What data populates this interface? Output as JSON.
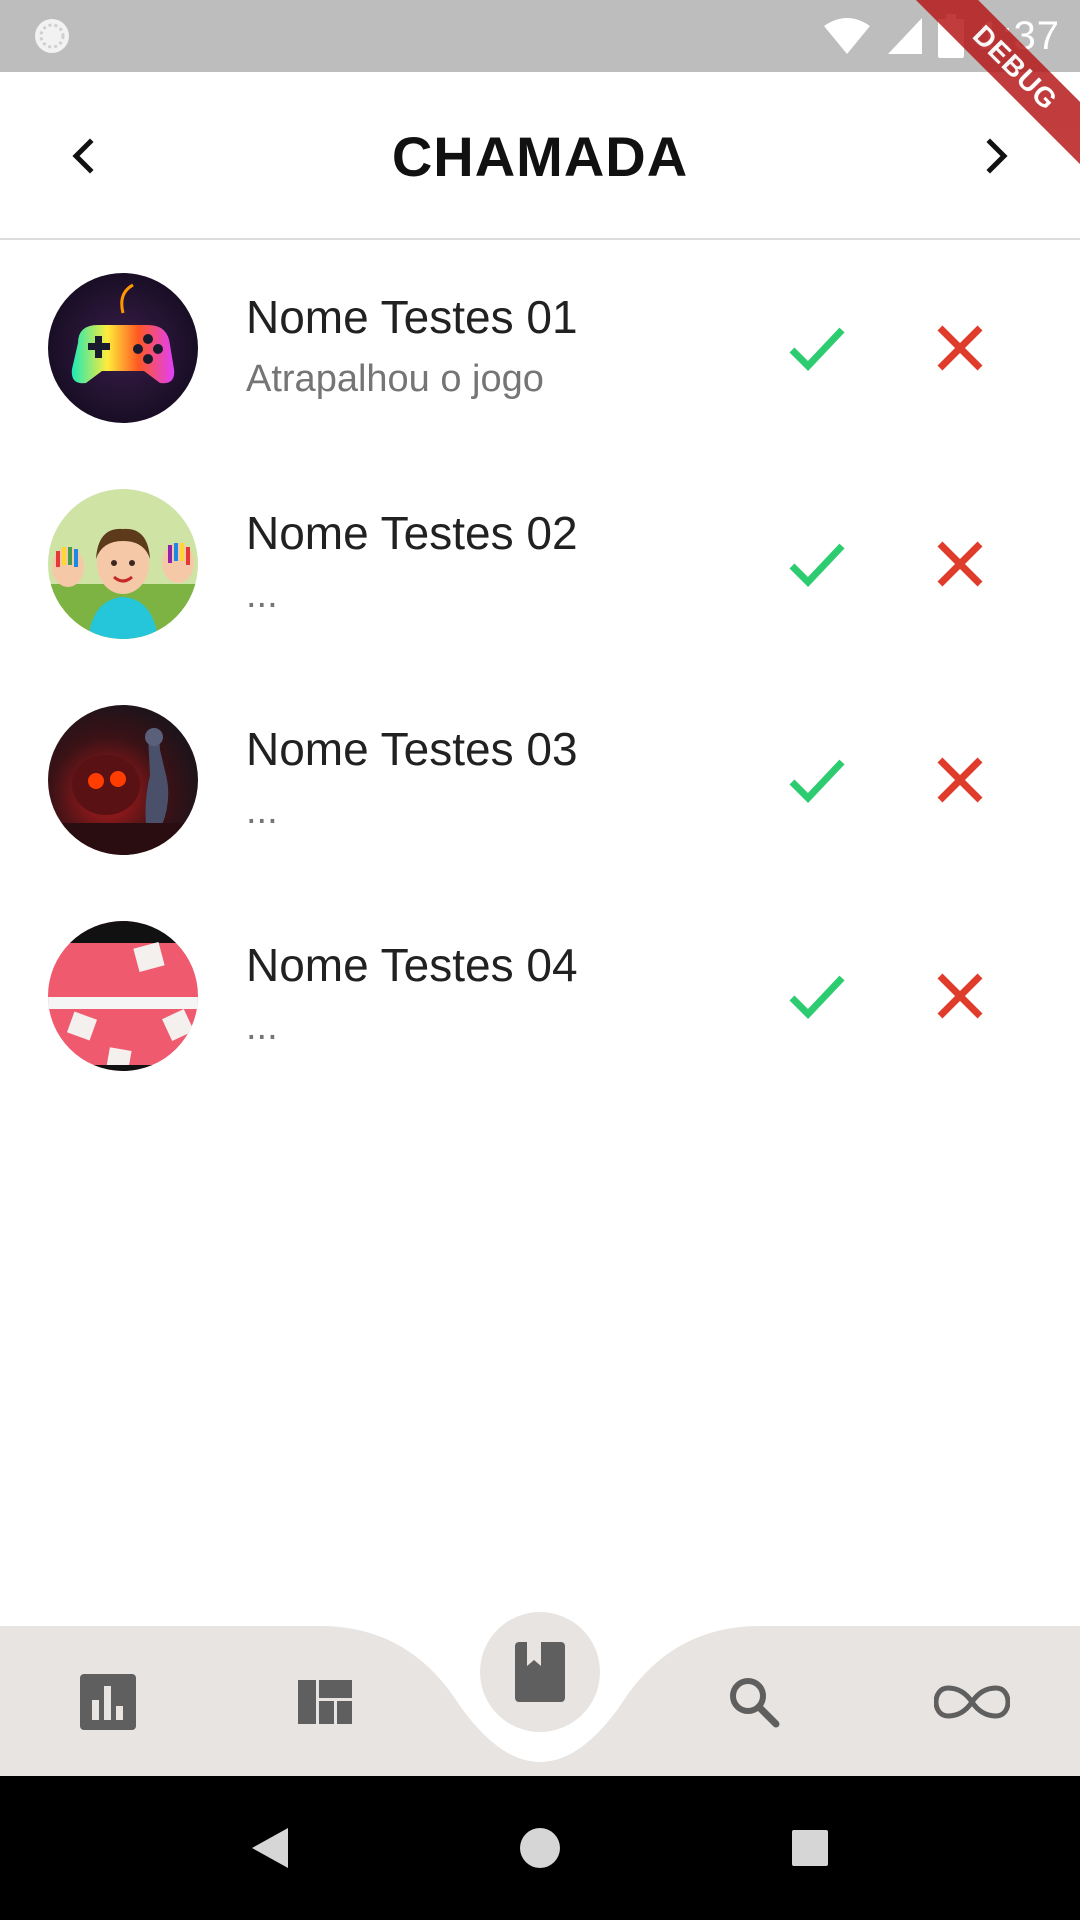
{
  "status_bar": {
    "time": "1:37",
    "icons": [
      "loading-circle-icon",
      "wifi-icon",
      "signal-icon",
      "battery-icon"
    ]
  },
  "debug_banner": "DEBUG",
  "header": {
    "title": "CHAMADA",
    "prev_icon": "chevron-left-icon",
    "next_icon": "chevron-right-icon"
  },
  "list": {
    "items": [
      {
        "name": "Nome Testes 01",
        "subtitle": "Atrapalhou o jogo",
        "avatar": "gamepad-neon-avatar"
      },
      {
        "name": "Nome Testes 02",
        "subtitle": "...",
        "avatar": "child-painted-hands-avatar"
      },
      {
        "name": "Nome Testes 03",
        "subtitle": "...",
        "avatar": "dark-fantasy-avatar"
      },
      {
        "name": "Nome Testes 04",
        "subtitle": "...",
        "avatar": "pink-sugar-cubes-avatar"
      }
    ],
    "present_icon": "check-icon",
    "absent_icon": "close-icon"
  },
  "bottom_nav": {
    "items": [
      "bar-chart-icon",
      "dashboard-icon",
      "book-icon",
      "search-icon",
      "infinity-icon"
    ],
    "active": "book-icon"
  },
  "system_nav": [
    "back-icon",
    "home-icon",
    "recents-icon"
  ],
  "colors": {
    "status_bar": "#bdbdbd",
    "check": "#2ecc71",
    "cross": "#e03c2b",
    "nav_background": "#e8e4e1",
    "nav_icon": "#5f5f5f",
    "debug_ribbon": "#b71c1c"
  }
}
